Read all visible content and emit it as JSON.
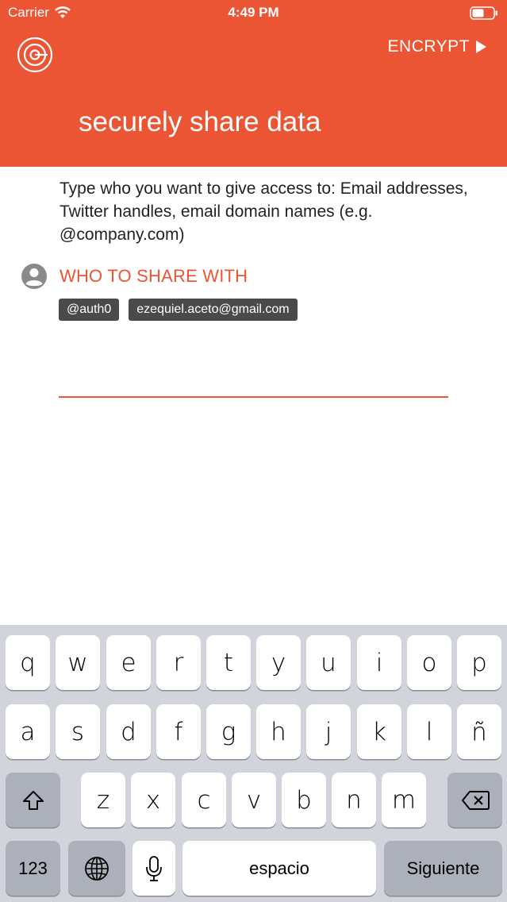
{
  "status_bar": {
    "carrier": "Carrier",
    "time": "4:49 PM"
  },
  "header": {
    "action_label": "ENCRYPT",
    "title": "securely share data"
  },
  "content": {
    "instructions": "Type who you want to give access to: Email addresses, Twitter handles, email domain names (e.g. @company.com)",
    "share_label": "WHO TO SHARE WITH",
    "chips": [
      "@auth0",
      "ezequiel.aceto@gmail.com"
    ]
  },
  "keyboard": {
    "row1": [
      "q",
      "w",
      "e",
      "r",
      "t",
      "y",
      "u",
      "i",
      "o",
      "p"
    ],
    "row2": [
      "a",
      "s",
      "d",
      "f",
      "g",
      "h",
      "j",
      "k",
      "l",
      "ñ"
    ],
    "row3": [
      "z",
      "x",
      "c",
      "v",
      "b",
      "n",
      "m"
    ],
    "numbers_label": "123",
    "space_label": "espacio",
    "return_label": "Siguiente"
  },
  "colors": {
    "accent": "#EB5533",
    "keyboard_bg": "#D1D4DA",
    "chip_bg": "#4a4a4a"
  },
  "icons": [
    "wifi-icon",
    "battery-icon",
    "app-logo-icon",
    "play-icon",
    "person-icon",
    "shift-icon",
    "backspace-icon",
    "globe-icon",
    "microphone-icon"
  ]
}
